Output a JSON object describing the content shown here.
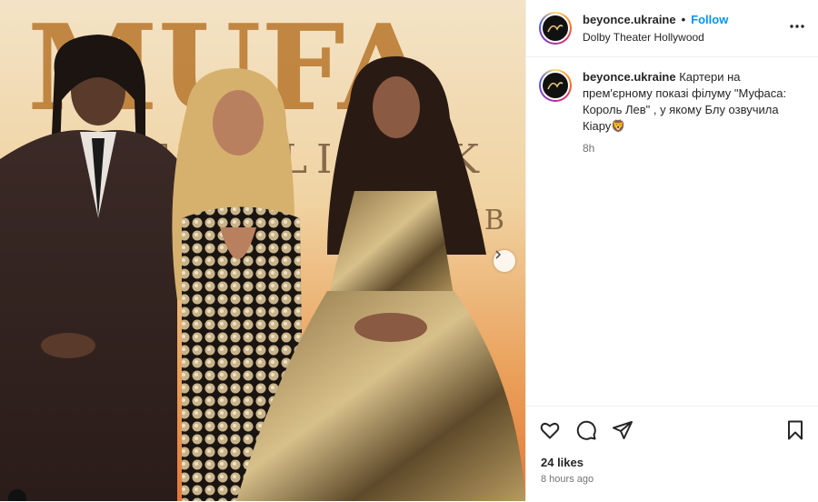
{
  "post": {
    "username": "beyonce.ukraine",
    "follow_label": "Follow",
    "separator": "•",
    "location": "Dolby Theater Hollywood",
    "caption_username": "beyonce.ukraine",
    "caption_text": "Картери на прем'єрному показі філуму \"Муфаса: Король Лев\" , у якому Блу озвучила Кіару🦁",
    "caption_age": "8h",
    "likes": "24 likes",
    "posted": "8 hours ago"
  },
  "photo": {
    "backdrop_title": "MUFA",
    "backdrop_subtitle_1": "THE LION K",
    "backdrop_subtitle_2": "IB"
  },
  "icons": {
    "more": "more-options-icon",
    "like": "heart-icon",
    "comment": "comment-icon",
    "share": "share-icon",
    "save": "bookmark-icon",
    "next": "chevron-right-icon"
  },
  "colors": {
    "accent": "#0095f6",
    "text": "#262626",
    "muted": "#737373"
  }
}
